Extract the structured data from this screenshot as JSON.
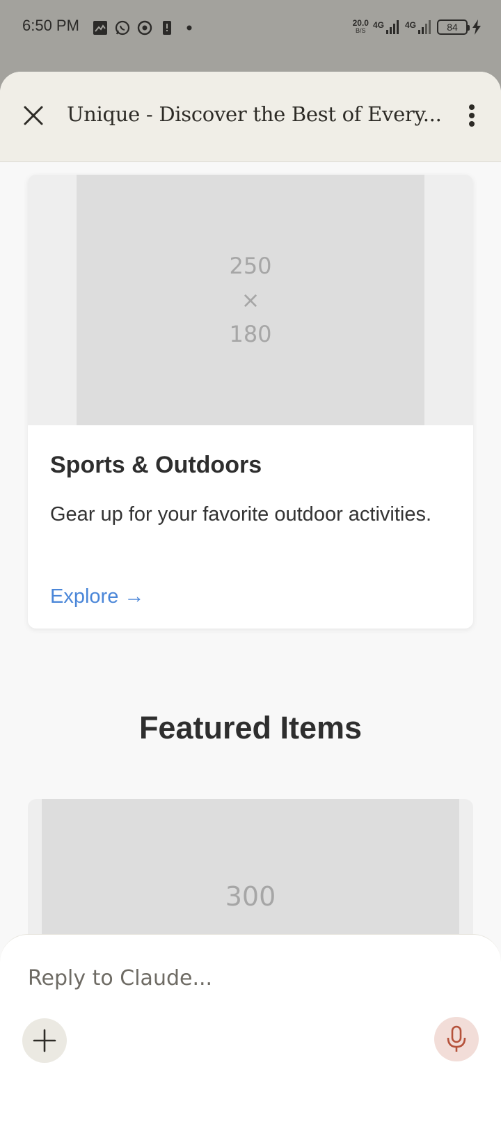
{
  "status_bar": {
    "time": "6:50 PM",
    "notification_icons": [
      "gallery-icon",
      "whatsapp-icon",
      "chrome-icon",
      "phone-alert-icon",
      "dot-icon"
    ],
    "net_speed_value": "20.0",
    "net_speed_unit": "B/S",
    "network_1": "4G",
    "network_2": "4G",
    "battery_level": "84"
  },
  "app_bar": {
    "title": "Unique - Discover the Best of Every..."
  },
  "category_card": {
    "image_width": "250",
    "image_x": "×",
    "image_height": "180",
    "title": "Sports & Outdoors",
    "description": "Gear up for your favorite outdoor activities.",
    "link": "Explore →"
  },
  "featured": {
    "heading": "Featured Items",
    "first_image_label": "300"
  },
  "composer": {
    "placeholder": "Reply to Claude..."
  },
  "colors": {
    "accent_link": "#4a86d8",
    "mic_accent": "#b5523b",
    "sheet_header": "#f0eee7"
  }
}
